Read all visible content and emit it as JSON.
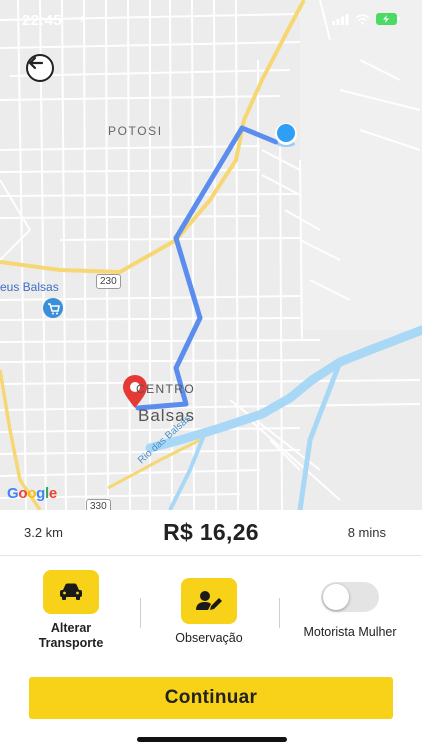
{
  "status_bar": {
    "time": "22:45"
  },
  "map": {
    "labels": {
      "district_potosi": "POTOSI",
      "district_centro": "CENTRO",
      "city": "Balsas",
      "poi_museum": "eus Balsas",
      "river": "Rio das Balsas"
    },
    "road_badges": [
      "230",
      "330"
    ],
    "attribution": {
      "letters": [
        "G",
        "o",
        "o",
        "g",
        "l",
        "e"
      ],
      "colors": [
        "#4285F4",
        "#EA4335",
        "#FBBC05",
        "#4285F4",
        "#34A853",
        "#EA4335"
      ]
    },
    "colors": {
      "route": "#5b8def",
      "river": "#a8d8f5",
      "road_major": "#f6d773",
      "pin": "#e53935",
      "current_location": "#2f9ff5"
    },
    "icons": {
      "back": "arrow-left-icon",
      "destination": "map-pin-icon",
      "origin": "current-location-icon",
      "poi": "shopping-cart-icon"
    }
  },
  "trip": {
    "distance": "3.2 km",
    "price": "R$ 16,26",
    "duration": "8 mins"
  },
  "options": {
    "transport": {
      "label": "Alterar\nTransporte",
      "icon": "car-icon"
    },
    "notes": {
      "label": "Observação",
      "icon": "user-edit-icon"
    },
    "female_driver": {
      "label": "Motorista Mulher",
      "enabled": false
    }
  },
  "actions": {
    "continue_label": "Continuar"
  },
  "theme": {
    "accent": "#f7d218"
  }
}
